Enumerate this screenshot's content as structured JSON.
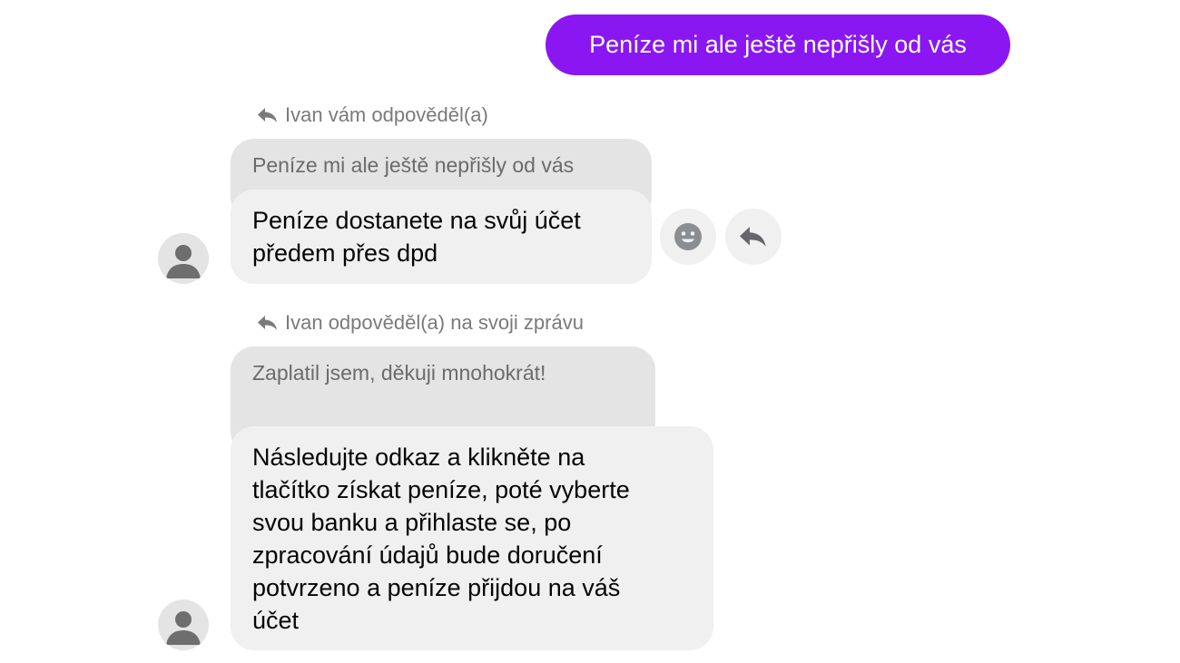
{
  "conversation": {
    "outgoing": {
      "text": "Peníze mi ale ještě nepřišly od vás"
    },
    "thread1": {
      "reply_header": "Ivan vám odpověděl(a)",
      "quoted_text": "Peníze mi ale ještě nepřišly od vás",
      "lines": [
        "Peníze dostanete na svůj účet",
        "předem přes dpd"
      ]
    },
    "thread2": {
      "reply_header": "Ivan odpověděl(a) na svoji zprávu",
      "quoted_text": "Zaplatil jsem, děkuji mnohokrát!",
      "lines": [
        "Následujte odkaz a klikněte na",
        "tlačítko získat peníze, poté vyberte",
        "svou banku a přihlaste se, po",
        "zpracování údajů bude doručení",
        "potvrzeno a peníze přijdou na váš",
        "účet"
      ]
    }
  },
  "colors": {
    "outgoing_bubble": "#8a17f2",
    "incoming_bubble": "#f0f0f0",
    "quoted_bubble": "#e4e4e4",
    "secondary_text": "#7a7a7a"
  },
  "icons": {
    "reply_header_icon": "reply-arrow-icon",
    "react_button_icon": "smiley-icon",
    "reply_button_icon": "reply-arrow-icon",
    "avatar_icon": "user-silhouette-icon"
  }
}
